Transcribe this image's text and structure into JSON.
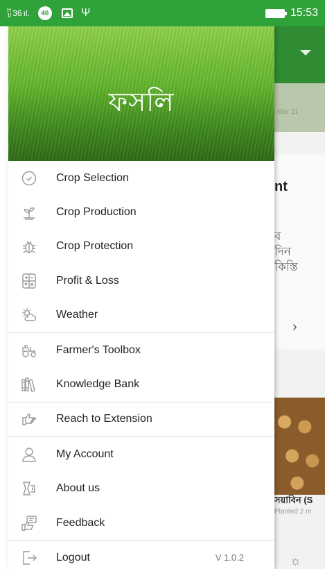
{
  "status_bar": {
    "signal_text": "36",
    "notification_badge": "46",
    "time": "15:53"
  },
  "app": {
    "logo_text": "ফসলি"
  },
  "drawer": {
    "items": [
      {
        "label": "Crop Selection",
        "icon": "check-circle-icon"
      },
      {
        "label": "Crop Production",
        "icon": "sprout-icon"
      },
      {
        "label": "Crop Protection",
        "icon": "bug-icon"
      },
      {
        "label": "Profit & Loss",
        "icon": "calculator-icon"
      },
      {
        "label": "Weather",
        "icon": "sun-cloud-icon"
      },
      {
        "label": "Farmer's Toolbox",
        "icon": "tractor-icon"
      },
      {
        "label": "Knowledge Bank",
        "icon": "books-icon"
      },
      {
        "label": "Reach to Extension",
        "icon": "pointing-hand-icon"
      },
      {
        "label": "My Account",
        "icon": "user-icon"
      },
      {
        "label": "About us",
        "icon": "taka-doc-icon"
      },
      {
        "label": "Feedback",
        "icon": "feedback-icon"
      },
      {
        "label": "Logout",
        "icon": "logout-icon"
      }
    ],
    "version": "V 1.0.2"
  },
  "background": {
    "date_text": "Mar 11",
    "card_title_partial": "nt",
    "card_text_lines": [
      "ব",
      "দিন",
      "কিস্তি"
    ],
    "crop_title_partial": "সয়াবিন (S",
    "crop_sub_partial": "Planted 2 m"
  }
}
